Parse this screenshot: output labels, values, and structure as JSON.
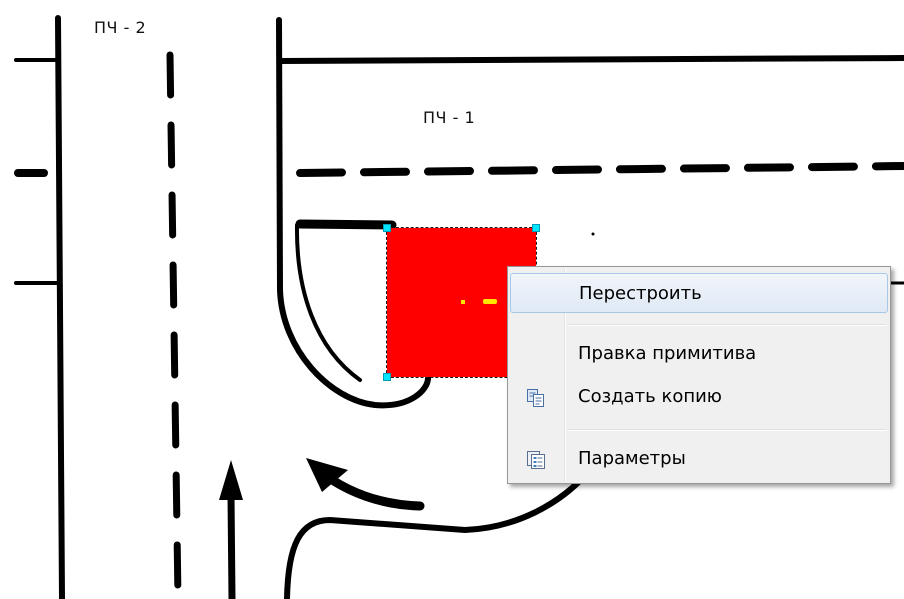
{
  "map": {
    "labels": {
      "area_2": "ПЧ - 2",
      "area_1": "ПЧ - 1"
    },
    "selection": {
      "fill_color": "#ff0000",
      "handle_color": "#00e5ff",
      "marker_color": "#ffe600"
    }
  },
  "context_menu": {
    "items": [
      {
        "label": "Перестроить",
        "icon": "none",
        "highlighted": true
      },
      {
        "label": "Правка примитива",
        "icon": "none",
        "highlighted": false
      },
      {
        "label": "Создать копию",
        "icon": "copy-icon",
        "highlighted": false
      },
      {
        "label": "Параметры",
        "icon": "properties-icon",
        "highlighted": false
      }
    ]
  }
}
